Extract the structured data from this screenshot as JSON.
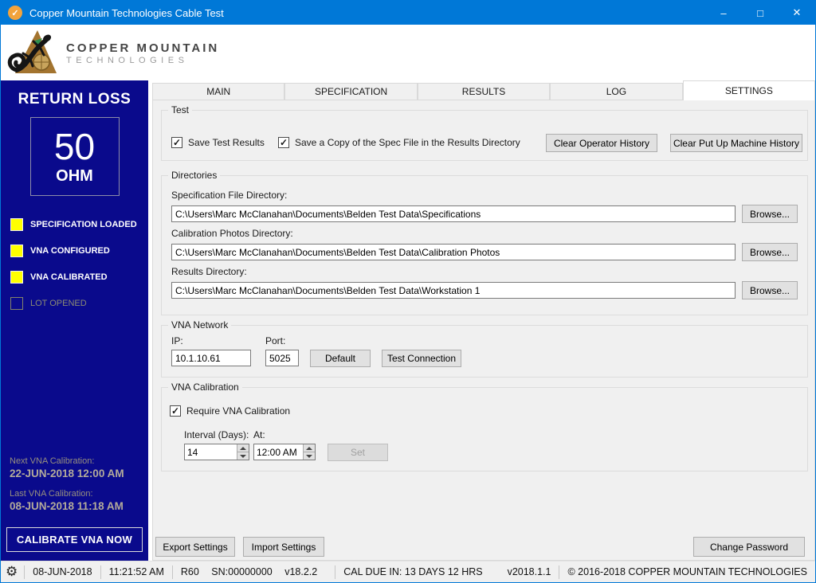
{
  "window": {
    "title": "Copper Mountain Technologies Cable Test"
  },
  "icons": {
    "check": "✓",
    "minimize": "–",
    "maximize": "□",
    "close": "✕",
    "gear": "⚙"
  },
  "logo": {
    "line1": "COPPER MOUNTAIN",
    "line2": "TECHNOLOGIES"
  },
  "sidebar": {
    "impedance_label": "RETURN LOSS",
    "impedance_value": "50",
    "impedance_unit": "OHM",
    "statuses": [
      {
        "label": "SPECIFICATION LOADED",
        "active": true
      },
      {
        "label": "VNA CONFIGURED",
        "active": true
      },
      {
        "label": "VNA CALIBRATED",
        "active": true
      },
      {
        "label": "LOT OPENED",
        "active": false
      }
    ],
    "next_cal_label": "Next VNA Calibration:",
    "next_cal_value": "22-JUN-2018 12:00 AM",
    "last_cal_label": "Last VNA Calibration:",
    "last_cal_value": "08-JUN-2018 11:18 AM",
    "calibrate_button": "CALIBRATE VNA NOW"
  },
  "tabs": [
    {
      "label": "MAIN",
      "selected": false
    },
    {
      "label": "SPECIFICATION",
      "selected": false
    },
    {
      "label": "RESULTS",
      "selected": false
    },
    {
      "label": "LOG",
      "selected": false
    },
    {
      "label": "SETTINGS",
      "selected": true
    }
  ],
  "settings": {
    "test_group": {
      "title": "Test",
      "save_results_checkbox": "Save Test Results",
      "save_spec_checkbox": "Save a Copy of the Spec File in the Results Directory",
      "clear_operator_button": "Clear Operator History",
      "clear_machine_button": "Clear Put Up Machine History"
    },
    "directories_group": {
      "title": "Directories",
      "fields": [
        {
          "label": "Specification File Directory:",
          "value": "C:\\Users\\Marc McClanahan\\Documents\\Belden Test Data\\Specifications",
          "button": "Browse..."
        },
        {
          "label": "Calibration Photos Directory:",
          "value": "C:\\Users\\Marc McClanahan\\Documents\\Belden Test Data\\Calibration Photos",
          "button": "Browse..."
        },
        {
          "label": "Results Directory:",
          "value": "C:\\Users\\Marc McClanahan\\Documents\\Belden Test Data\\Workstation 1",
          "button": "Browse..."
        }
      ]
    },
    "network_group": {
      "title": "VNA Network",
      "ip_label": "IP:",
      "ip_value": "10.1.10.61",
      "port_label": "Port:",
      "port_value": "5025",
      "default_button": "Default",
      "test_button": "Test Connection"
    },
    "calibration_group": {
      "title": "VNA Calibration",
      "require_checkbox": "Require VNA Calibration",
      "interval_label": "Interval (Days):",
      "interval_value": "14",
      "at_label": "At:",
      "at_value": "12:00 AM",
      "set_button": "Set"
    },
    "export_button": "Export Settings",
    "import_button": "Import Settings",
    "change_password_button": "Change Password"
  },
  "statusbar": {
    "date": "08-JUN-2018",
    "time": "11:21:52 AM",
    "device": {
      "model": "R60",
      "serial": "SN:00000000",
      "firmware": "v18.2.2"
    },
    "cal_due": "CAL DUE IN: 13 DAYS 12 HRS",
    "app_version": "v2018.1.1",
    "copyright": "© 2016-2018 COPPER MOUNTAIN TECHNOLOGIES"
  },
  "colors": {
    "titlebar_blue": "#0078d7",
    "sidebar_navy": "#0a0a8c",
    "status_yellow": "#ffff00",
    "logo_copper": "#a3742f"
  }
}
